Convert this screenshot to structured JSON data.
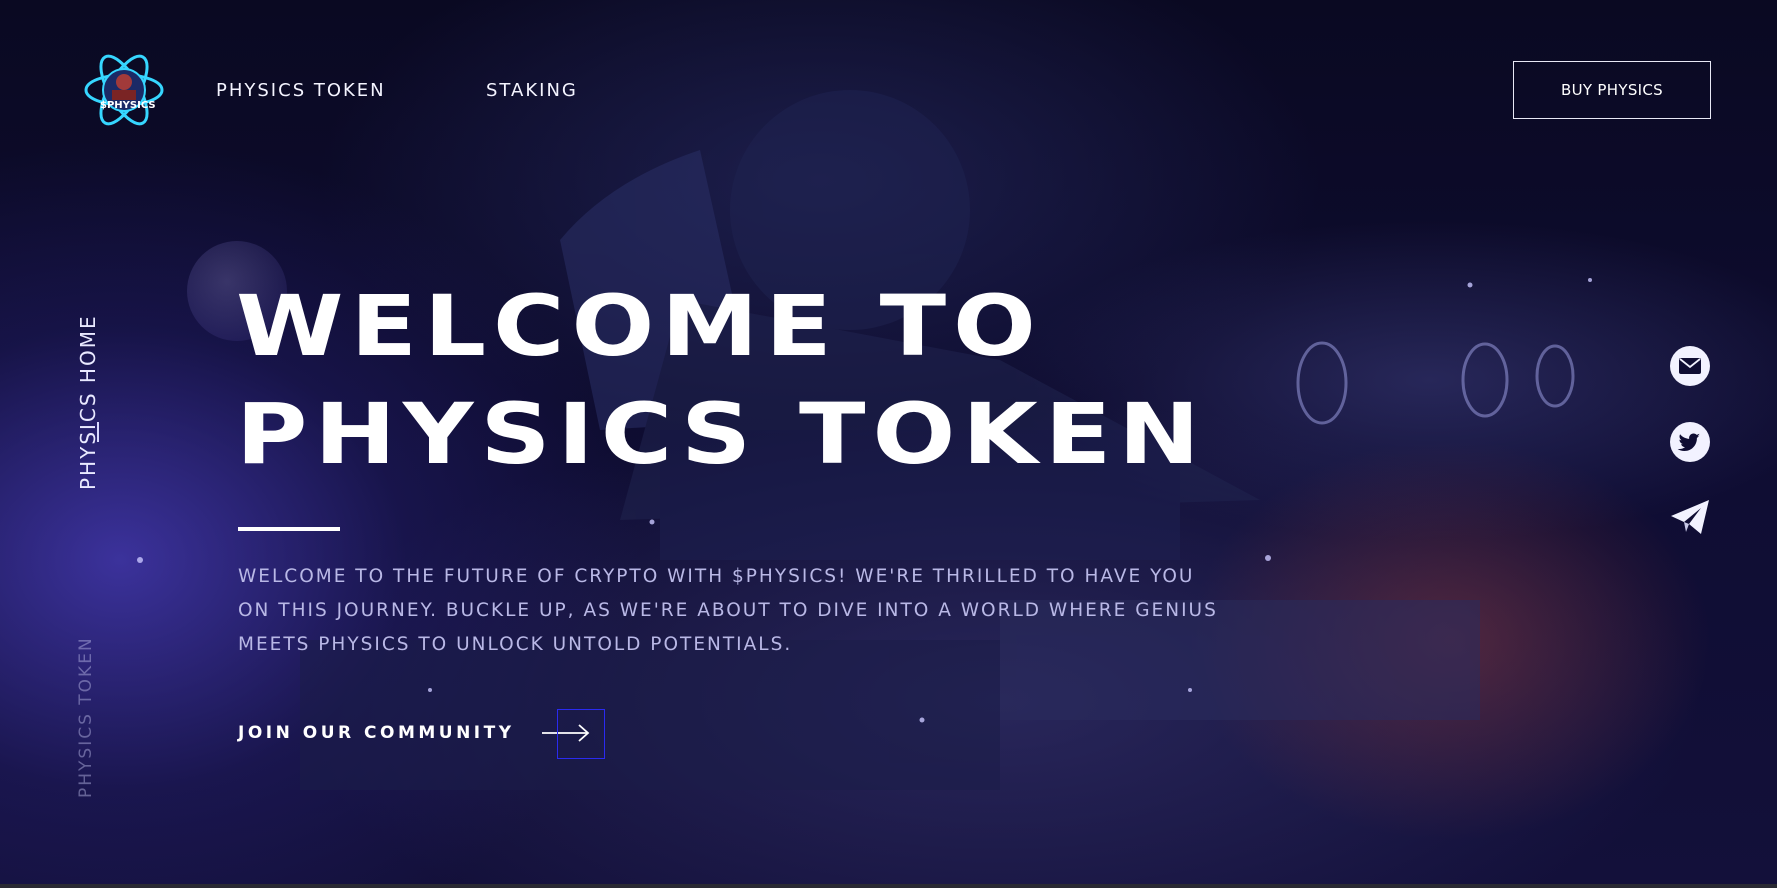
{
  "header": {
    "logo_text": "$PHYSICS",
    "nav": [
      {
        "label": "PHYSICS TOKEN"
      },
      {
        "label": "STAKING"
      }
    ],
    "buy_button": "BUY PHYSICS"
  },
  "side": {
    "active_label": "PHYSICS HOME",
    "inactive_label": "PHYSICS TOKEN"
  },
  "hero": {
    "title_line1": "WELCOME TO",
    "title_line2": "PHYSICS TOKEN",
    "description": "WELCOME TO THE FUTURE OF CRYPTO WITH $PHYSICS! WE'RE THRILLED TO HAVE YOU ON THIS JOURNEY. BUCKLE UP, AS WE'RE ABOUT TO DIVE INTO A WORLD WHERE GENIUS MEETS PHYSICS TO UNLOCK UNTOLD POTENTIALS.",
    "cta_label": "JOIN OUR COMMUNITY",
    "cta_icon": "arrow-right-icon"
  },
  "social": [
    {
      "icon": "mail-icon"
    },
    {
      "icon": "twitter-icon"
    },
    {
      "icon": "telegram-icon"
    }
  ],
  "colors": {
    "background": "#0b0a26",
    "accent": "#4a3ebe",
    "text": "#ffffff",
    "muted_text": "#b9b8e6",
    "focus_outline": "#2a2af0"
  }
}
